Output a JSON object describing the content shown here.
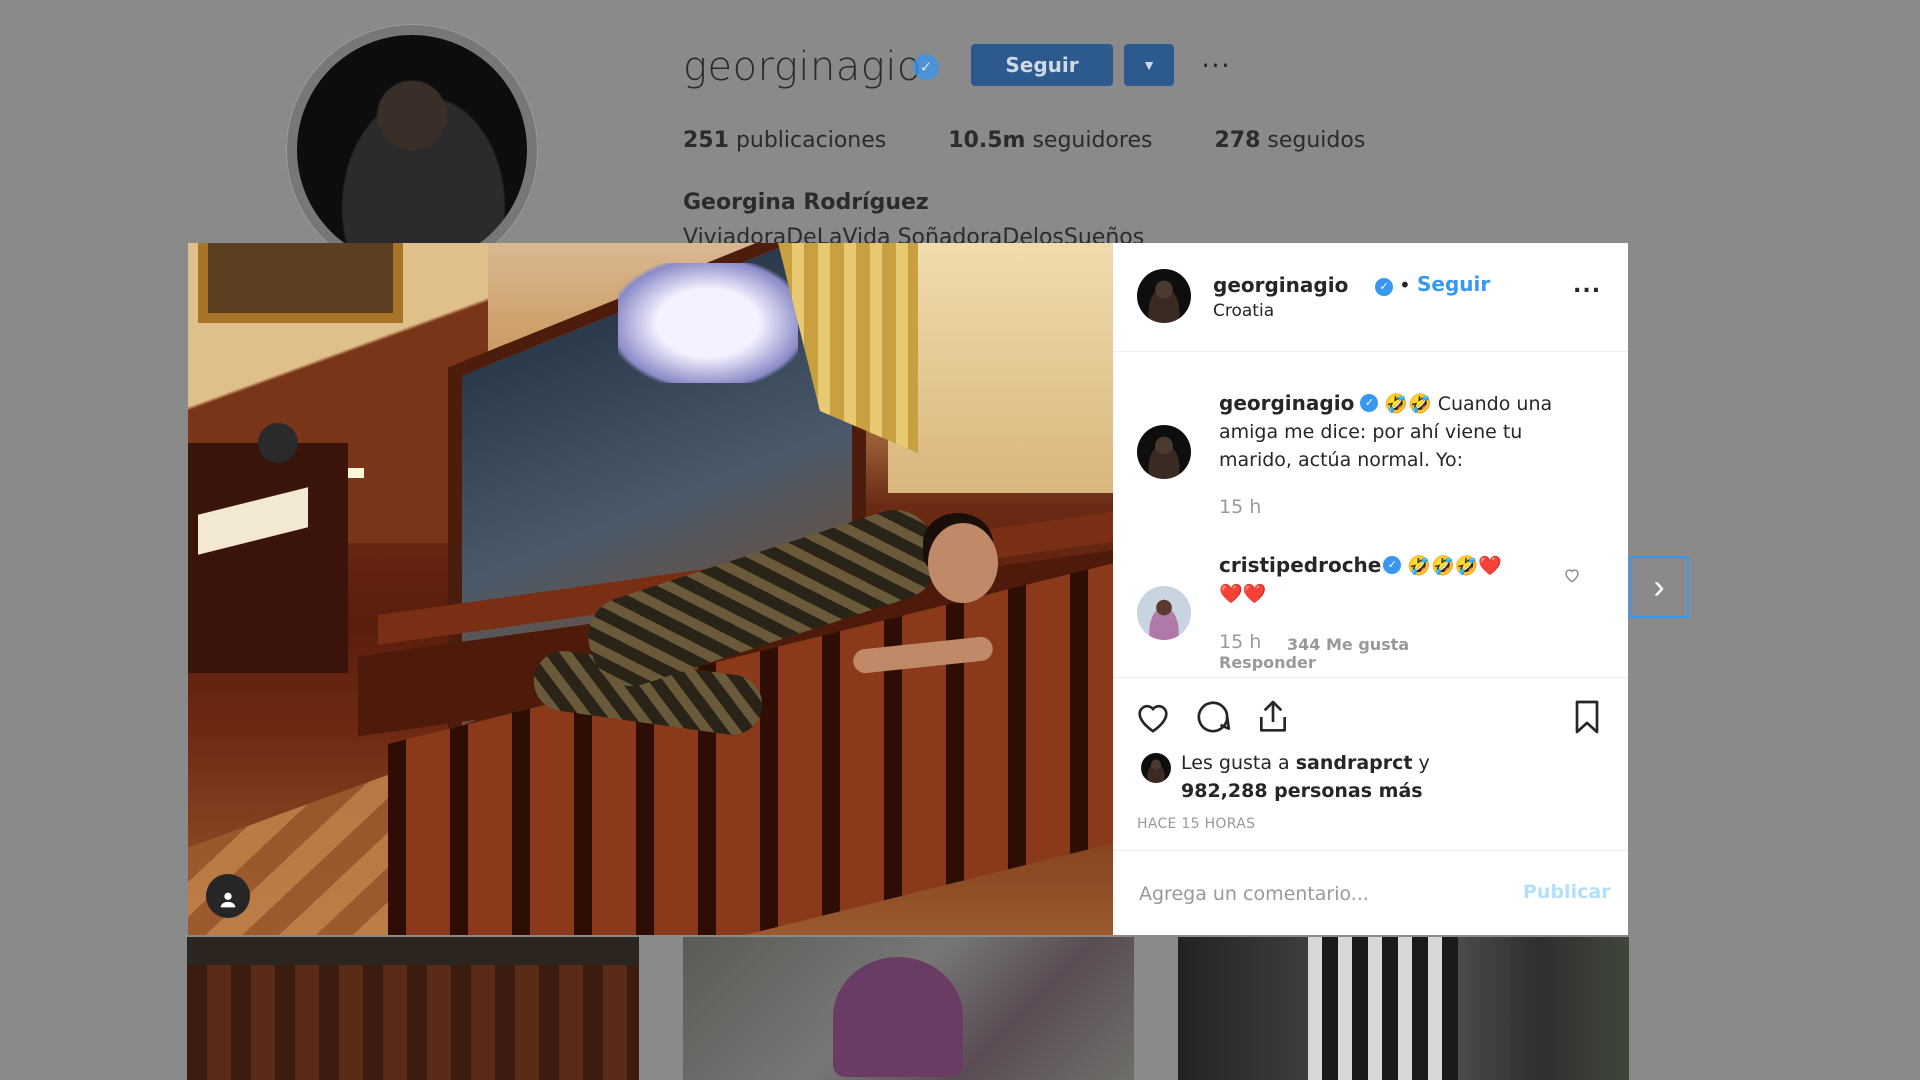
{
  "profile": {
    "username": "georginagio",
    "follow_label": "Seguir",
    "more_label": "...",
    "posts_count": "251",
    "posts_label": "publicaciones",
    "followers_count": "10.5m",
    "followers_label": "seguidores",
    "following_count": "278",
    "following_label": "seguidos",
    "full_name": "Georgina Rodríguez",
    "bio": "ViviadoraDeLaVida SoñadoraDelosSueños"
  },
  "post": {
    "username": "georginagio",
    "follow_label": "Seguir",
    "location": "Croatia",
    "more_label": "...",
    "caption_username": "georginagio",
    "caption_emojis": "🤣🤣",
    "caption_text": "Cuando una amiga me dice: por ahí viene tu marido, actúa normal. Yo:",
    "caption_time": "15 h",
    "comments": [
      {
        "username": "cristipedroche",
        "text": "🤣🤣🤣❤️❤️❤️",
        "time": "15 h",
        "likes": "344 Me gusta",
        "reply_label": "Responder"
      }
    ],
    "likes_prefix": "Les gusta a",
    "likes_user": "sandraprct",
    "likes_mid": "y",
    "likes_count": "982,288 personas más",
    "timestamp": "HACE 15 HORAS",
    "comment_placeholder": "Agrega un comentario...",
    "publish_label": "Publicar"
  },
  "colors": {
    "accent": "#3897f0",
    "publish_disabled": "#b2dffc",
    "overlay": "#8a8a8a"
  },
  "icons": [
    "verified-icon",
    "heart-icon",
    "comment-icon",
    "share-icon",
    "bookmark-icon",
    "user-tag-icon",
    "chevron-right-icon",
    "more-icon"
  ]
}
